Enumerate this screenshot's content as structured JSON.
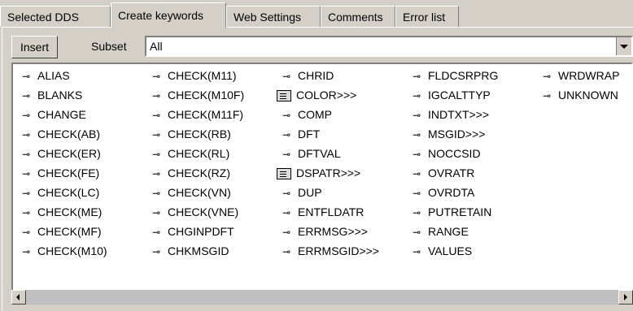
{
  "tabs": [
    {
      "label": "Selected DDS"
    },
    {
      "label": "Create keywords"
    },
    {
      "label": "Web Settings"
    },
    {
      "label": "Comments"
    },
    {
      "label": "Error list"
    }
  ],
  "toolbar": {
    "insert_label": "Insert",
    "subset_label": "Subset",
    "subset_value": "All"
  },
  "keywords": [
    {
      "label": "ALIAS",
      "icon": "key-icon"
    },
    {
      "label": "BLANKS",
      "icon": "key-icon"
    },
    {
      "label": "CHANGE",
      "icon": "key-icon"
    },
    {
      "label": "CHECK(AB)",
      "icon": "key-icon"
    },
    {
      "label": "CHECK(ER)",
      "icon": "key-icon"
    },
    {
      "label": "CHECK(FE)",
      "icon": "key-icon"
    },
    {
      "label": "CHECK(LC)",
      "icon": "key-icon"
    },
    {
      "label": "CHECK(ME)",
      "icon": "key-icon"
    },
    {
      "label": "CHECK(MF)",
      "icon": "key-icon"
    },
    {
      "label": "CHECK(M10)",
      "icon": "key-icon"
    },
    {
      "label": "CHECK(M11)",
      "icon": "key-icon"
    },
    {
      "label": "CHECK(M10F)",
      "icon": "key-icon"
    },
    {
      "label": "CHECK(M11F)",
      "icon": "key-icon"
    },
    {
      "label": "CHECK(RB)",
      "icon": "key-icon"
    },
    {
      "label": "CHECK(RL)",
      "icon": "key-icon"
    },
    {
      "label": "CHECK(RZ)",
      "icon": "key-icon"
    },
    {
      "label": "CHECK(VN)",
      "icon": "key-icon"
    },
    {
      "label": "CHECK(VNE)",
      "icon": "key-icon"
    },
    {
      "label": "CHGINPDFT",
      "icon": "key-icon"
    },
    {
      "label": "CHKMSGID",
      "icon": "key-icon"
    },
    {
      "label": "CHRID",
      "icon": "key-icon"
    },
    {
      "label": "COLOR>>>",
      "icon": "list-icon"
    },
    {
      "label": "COMP",
      "icon": "key-icon"
    },
    {
      "label": "DFT",
      "icon": "key-icon"
    },
    {
      "label": "DFTVAL",
      "icon": "key-icon"
    },
    {
      "label": "DSPATR>>>",
      "icon": "list-icon"
    },
    {
      "label": "DUP",
      "icon": "key-icon"
    },
    {
      "label": "ENTFLDATR",
      "icon": "key-icon"
    },
    {
      "label": "ERRMSG>>>",
      "icon": "key-icon"
    },
    {
      "label": "ERRMSGID>>>",
      "icon": "key-icon"
    },
    {
      "label": "FLDCSRPRG",
      "icon": "key-icon"
    },
    {
      "label": "IGCALTTYP",
      "icon": "key-icon"
    },
    {
      "label": "INDTXT>>>",
      "icon": "key-icon"
    },
    {
      "label": "MSGID>>>",
      "icon": "key-icon"
    },
    {
      "label": "NOCCSID",
      "icon": "key-icon"
    },
    {
      "label": "OVRATR",
      "icon": "key-icon"
    },
    {
      "label": "OVRDTA",
      "icon": "key-icon"
    },
    {
      "label": "PUTRETAIN",
      "icon": "key-icon"
    },
    {
      "label": "RANGE",
      "icon": "key-icon"
    },
    {
      "label": "VALUES",
      "icon": "key-icon"
    },
    {
      "label": "WRDWRAP",
      "icon": "key-icon"
    },
    {
      "label": "UNKNOWN",
      "icon": "key-icon"
    }
  ]
}
